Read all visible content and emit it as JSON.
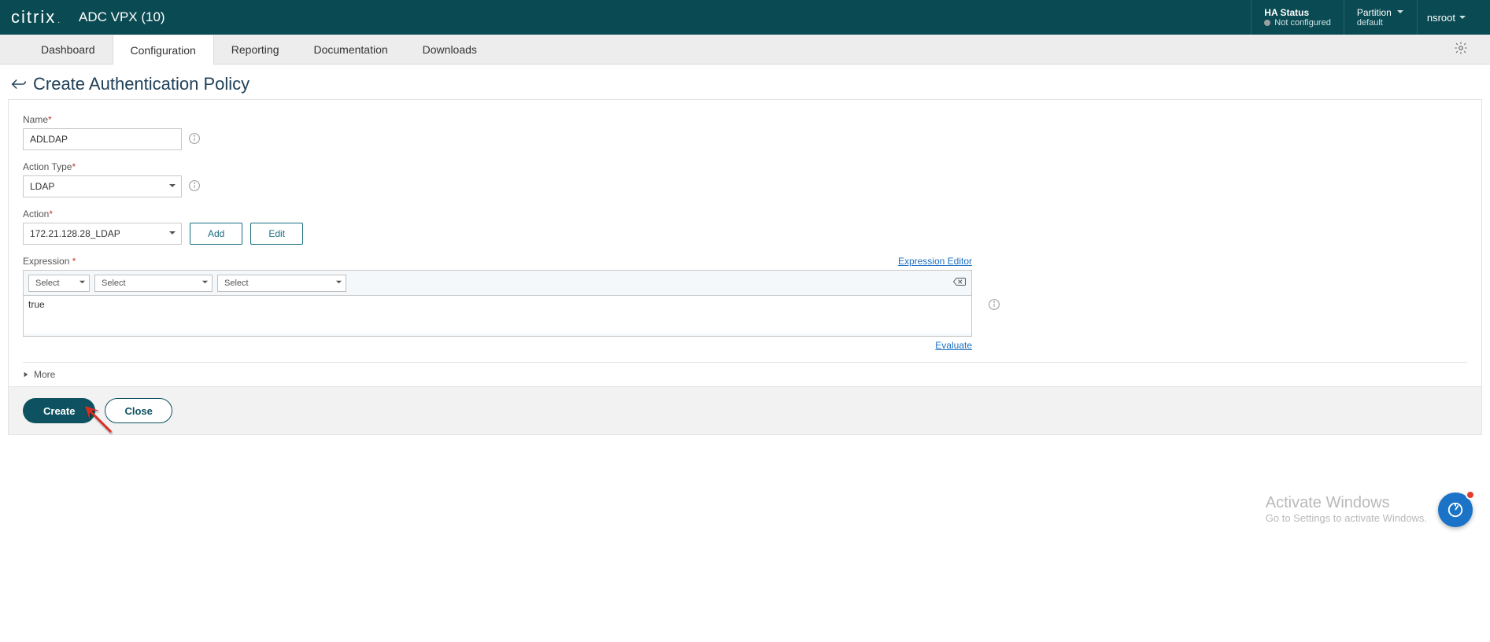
{
  "header": {
    "brand": "citrix",
    "brand_dot": ".",
    "product": "ADC VPX (10)",
    "ha_label": "HA Status",
    "ha_value": "Not configured",
    "partition_label": "Partition",
    "partition_value": "default",
    "user": "nsroot"
  },
  "nav": {
    "tabs": [
      {
        "label": "Dashboard",
        "active": false
      },
      {
        "label": "Configuration",
        "active": true
      },
      {
        "label": "Reporting",
        "active": false
      },
      {
        "label": "Documentation",
        "active": false
      },
      {
        "label": "Downloads",
        "active": false
      }
    ]
  },
  "page": {
    "title": "Create Authentication Policy"
  },
  "form": {
    "name_label": "Name",
    "name_value": "ADLDAP",
    "action_type_label": "Action Type",
    "action_type_value": "LDAP",
    "action_label": "Action",
    "action_value": "172.21.128.28_LDAP",
    "add_btn": "Add",
    "edit_btn": "Edit",
    "expression_label": "Expression",
    "expression_editor_link": "Expression Editor",
    "mini_select_placeholder": "Select",
    "expression_text": "true",
    "evaluate_link": "Evaluate",
    "more_label": "More"
  },
  "footer": {
    "create_btn": "Create",
    "close_btn": "Close"
  },
  "watermark": {
    "l1": "Activate Windows",
    "l2": "Go to Settings to activate Windows."
  }
}
